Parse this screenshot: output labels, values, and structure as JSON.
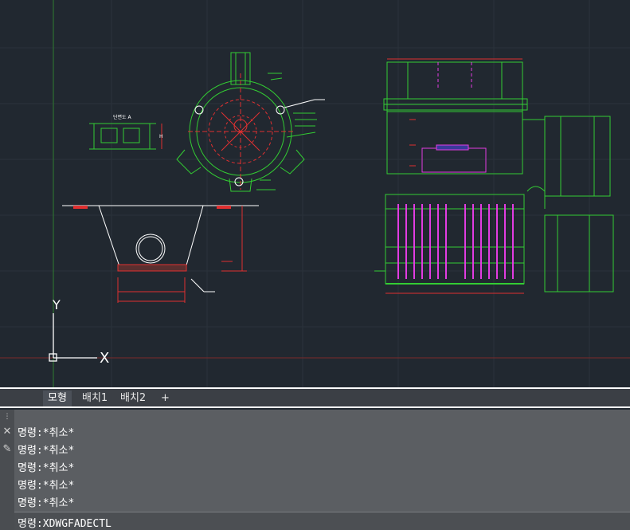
{
  "drawing": {
    "ucs_y_label": "Y",
    "ucs_x_label": "X",
    "section_title": "단면도 A",
    "dim_h_label": "H"
  },
  "layout_tabs": [
    {
      "label": "모형"
    },
    {
      "label": "배치1"
    },
    {
      "label": "배치2"
    },
    {
      "label": "+"
    }
  ],
  "command_history": [
    "명령:*취소*",
    "명령:*취소*",
    "명령:*취소*",
    "명령:*취소*",
    "명령:*취소*"
  ],
  "command_input": {
    "prompt": "명령:",
    "value": "XDWGFADECTL"
  },
  "icons": {
    "close": "close-icon",
    "pin": "pin-icon"
  },
  "colors": {
    "background": "#212830",
    "geometry_green": "#33cc33",
    "geometry_magenta": "#e23ce2",
    "geometry_red": "#e03030",
    "geometry_white": "#ffffff"
  }
}
